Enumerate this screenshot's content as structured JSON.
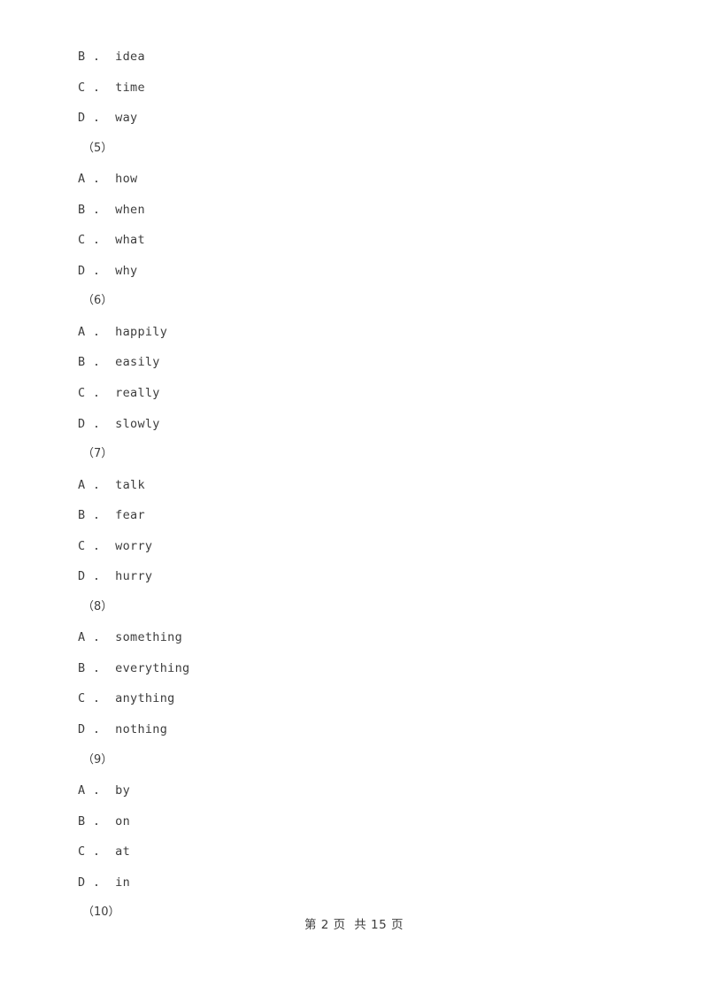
{
  "document": {
    "page_background": "#ffffff",
    "text_color": "#3d3d3d"
  },
  "lines": [
    {
      "type": "option",
      "letter": "B",
      "sep": " .  ",
      "text": "idea"
    },
    {
      "type": "option",
      "letter": "C",
      "sep": " .  ",
      "text": "time"
    },
    {
      "type": "option",
      "letter": "D",
      "sep": " .  ",
      "text": "way"
    },
    {
      "type": "qnum",
      "text": "（5）"
    },
    {
      "type": "option",
      "letter": "A",
      "sep": " .  ",
      "text": "how"
    },
    {
      "type": "option",
      "letter": "B",
      "sep": " .  ",
      "text": "when"
    },
    {
      "type": "option",
      "letter": "C",
      "sep": " .  ",
      "text": "what"
    },
    {
      "type": "option",
      "letter": "D",
      "sep": " .  ",
      "text": "why"
    },
    {
      "type": "qnum",
      "text": "（6）"
    },
    {
      "type": "option",
      "letter": "A",
      "sep": " .  ",
      "text": "happily"
    },
    {
      "type": "option",
      "letter": "B",
      "sep": " .  ",
      "text": "easily"
    },
    {
      "type": "option",
      "letter": "C",
      "sep": " .  ",
      "text": "really"
    },
    {
      "type": "option",
      "letter": "D",
      "sep": " .  ",
      "text": "slowly"
    },
    {
      "type": "qnum",
      "text": "（7）"
    },
    {
      "type": "option",
      "letter": "A",
      "sep": " .  ",
      "text": "talk"
    },
    {
      "type": "option",
      "letter": "B",
      "sep": " .  ",
      "text": "fear"
    },
    {
      "type": "option",
      "letter": "C",
      "sep": " .  ",
      "text": "worry"
    },
    {
      "type": "option",
      "letter": "D",
      "sep": " .  ",
      "text": "hurry"
    },
    {
      "type": "qnum",
      "text": "（8）"
    },
    {
      "type": "option",
      "letter": "A",
      "sep": " .  ",
      "text": "something"
    },
    {
      "type": "option",
      "letter": "B",
      "sep": " .  ",
      "text": "everything"
    },
    {
      "type": "option",
      "letter": "C",
      "sep": " .  ",
      "text": "anything"
    },
    {
      "type": "option",
      "letter": "D",
      "sep": " .  ",
      "text": "nothing"
    },
    {
      "type": "qnum",
      "text": "（9）"
    },
    {
      "type": "option",
      "letter": "A",
      "sep": " .  ",
      "text": "by"
    },
    {
      "type": "option",
      "letter": "B",
      "sep": " .  ",
      "text": "on"
    },
    {
      "type": "option",
      "letter": "C",
      "sep": " .  ",
      "text": "at"
    },
    {
      "type": "option",
      "letter": "D",
      "sep": " .  ",
      "text": "in"
    },
    {
      "type": "qnum",
      "text": "（10）"
    }
  ],
  "footer": {
    "text": "第 2 页  共 15 页",
    "current_page": "2",
    "total_pages": "15"
  }
}
